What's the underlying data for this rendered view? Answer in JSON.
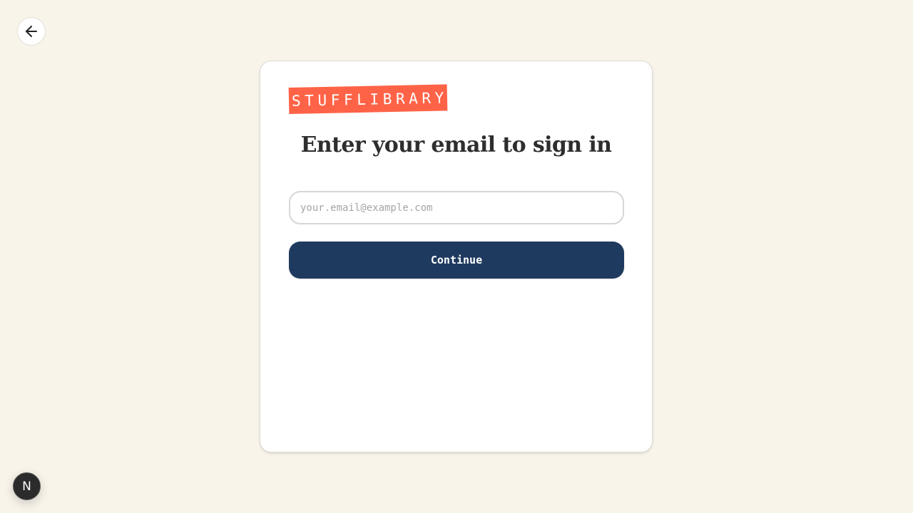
{
  "nav": {
    "back_icon": "arrow-left-icon"
  },
  "brand": {
    "logo_text": "STUFFLIBRARY",
    "logo_color": "#ff6347"
  },
  "signin": {
    "heading": "Enter your email to sign in",
    "email_placeholder": "your.email@example.com",
    "email_value": "",
    "continue_label": "Continue",
    "button_color": "#1f3a5f"
  },
  "dev_badge": {
    "label": "N",
    "icon": "nextjs-icon"
  }
}
